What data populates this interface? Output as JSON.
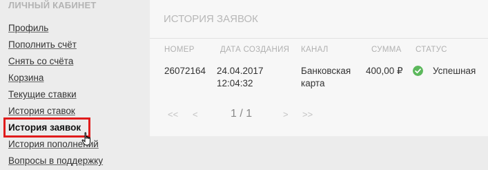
{
  "sidebar": {
    "title": "ЛИЧНЫЙ КАБИНЕТ",
    "items": [
      {
        "label": "Профиль"
      },
      {
        "label": "Пополнить счёт"
      },
      {
        "label": "Снять со счёта"
      },
      {
        "label": "Корзина"
      },
      {
        "label": "Текущие ставки"
      },
      {
        "label": "История ставок"
      },
      {
        "label": "История заявок",
        "active": true
      },
      {
        "label": "История пополнений"
      },
      {
        "label": "Вопросы в поддержку"
      }
    ]
  },
  "panel": {
    "title": "ИСТОРИЯ ЗАЯВОК",
    "columns": [
      "НОМЕР",
      "ДАТА СОЗДАНИЯ",
      "КАНАЛ",
      "СУММА",
      "СТАТУС"
    ],
    "rows": [
      {
        "number": "26072164",
        "date": "24.04.2017",
        "time": "12:04:32",
        "channel_line1": "Банковская",
        "channel_line2": "карта",
        "amount": "400,00 ₽",
        "status": "Успешная",
        "status_color": "#5cb85c"
      }
    ],
    "pager": {
      "first": "<<",
      "prev": "<",
      "info": "1 / 1",
      "next": ">",
      "last": ">>"
    }
  },
  "highlight_color": "#e01c1c"
}
